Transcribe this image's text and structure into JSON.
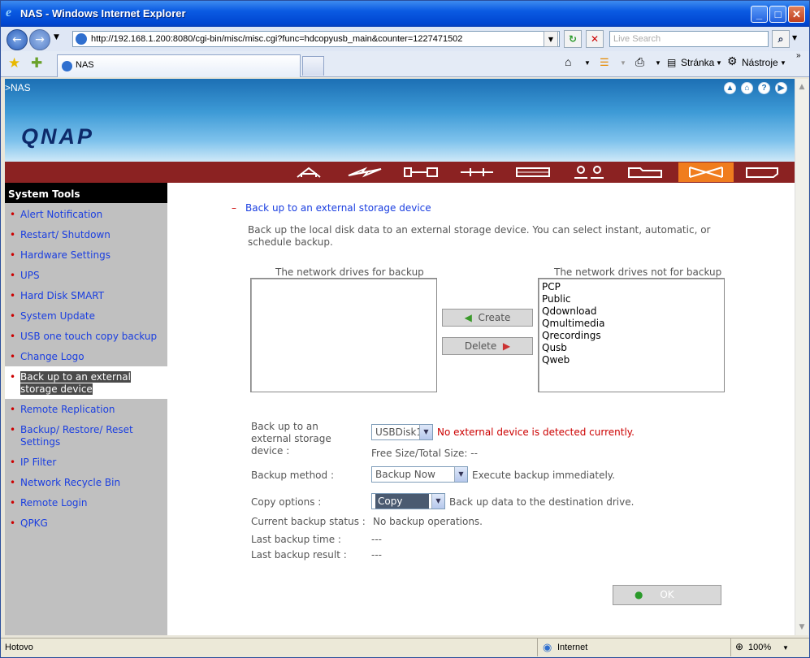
{
  "window": {
    "title": "NAS - Windows Internet Explorer"
  },
  "address": {
    "url": "http://192.168.1.200:8080/cgi-bin/misc/misc.cgi?func=hdcopyusb_main&counter=1227471502",
    "search_placeholder": "Live Search"
  },
  "tab": {
    "label": "NAS"
  },
  "toolbar": {
    "page_label": "Stránka",
    "tools_label": "Nástroje"
  },
  "banner": {
    "breadcrumb": ">NAS",
    "logo": "QNAP"
  },
  "sidebar": {
    "header": "System Tools",
    "items": [
      {
        "label": "Alert Notification"
      },
      {
        "label": "Restart/ Shutdown"
      },
      {
        "label": "Hardware Settings"
      },
      {
        "label": "UPS"
      },
      {
        "label": "Hard Disk SMART"
      },
      {
        "label": "System Update"
      },
      {
        "label": "USB one touch copy backup"
      },
      {
        "label": "Change Logo"
      },
      {
        "label": "Back up to an external storage device"
      },
      {
        "label": "Remote Replication"
      },
      {
        "label": "Backup/ Restore/ Reset Settings"
      },
      {
        "label": "IP Filter"
      },
      {
        "label": "Network Recycle Bin"
      },
      {
        "label": "Remote Login"
      },
      {
        "label": "QPKG"
      }
    ]
  },
  "main": {
    "section_title": "Back up to an external storage device",
    "collapse_symbol": "–",
    "description": "Back up the local disk data to an external storage device. You can select instant, automatic, or schedule backup.",
    "left_list_label": "The network drives for backup",
    "right_list_label": "The network drives not for backup",
    "right_list_items": [
      "PCP",
      "Public",
      "Qdownload",
      "Qmultimedia",
      "Qrecordings",
      "Qusb",
      "Qweb"
    ],
    "create_label": "Create",
    "delete_label": "Delete",
    "device_label": "Back up to an external storage device :",
    "device_value": "USBDisk1",
    "device_error": "No external device is detected currently.",
    "free_size": "Free Size/Total Size: --",
    "method_label": "Backup method :",
    "method_value": "Backup Now",
    "method_note": "Execute backup immediately.",
    "copy_label": "Copy options :",
    "copy_value": "Copy",
    "copy_note": "Back up data to the destination drive.",
    "status_label": "Current backup status :",
    "status_value": "No backup operations.",
    "time_label": "Last backup time :",
    "time_value": "---",
    "result_label": "Last backup result :",
    "result_value": "---",
    "ok_label": "OK"
  },
  "statusbar": {
    "left": "Hotovo",
    "zone": "Internet",
    "zoom": "100%"
  },
  "colors": {
    "accent": "#f07d1e",
    "menubar": "#8b2222",
    "link": "#1a3ee0",
    "error": "#cc0000"
  }
}
